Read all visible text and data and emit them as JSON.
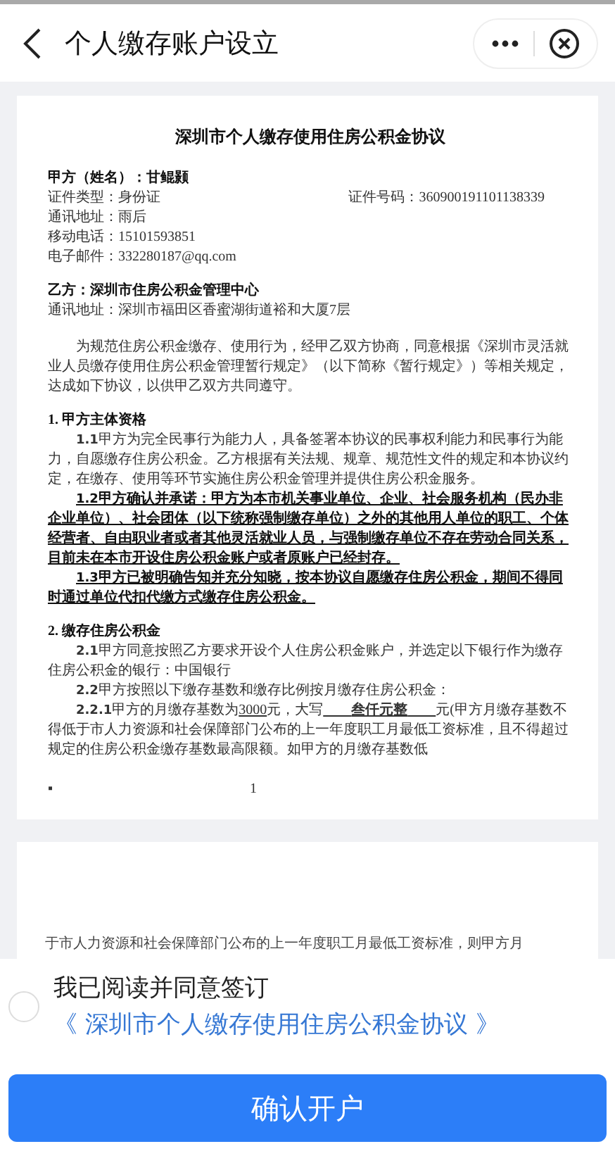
{
  "header": {
    "title": "个人缴存账户设立"
  },
  "document": {
    "title": "深圳市个人缴存使用住房公积金协议",
    "party_a": {
      "heading": "甲方（姓名）：甘鲲颢",
      "id_type": "证件类型：身份证",
      "id_number": "证件号码：360900191101138339",
      "address": "通讯地址：雨后",
      "phone": "移动电话：15101593851",
      "email": "电子邮件：332280187@qq.com"
    },
    "party_b": {
      "heading": "乙方：深圳市住房公积金管理中心",
      "address": "通讯地址：深圳市福田区香蜜湖街道裕和大厦7层"
    },
    "preamble": "为规范住房公积金缴存、使用行为，经甲乙双方协商，同意根据《深圳市灵活就业人员缴存使用住房公积金管理暂行规定》（以下简称《暂行规定》）等相关规定，达成如下协议，以供甲乙双方共同遵守。",
    "sections": [
      {
        "heading": "1. 甲方主体资格",
        "clauses": [
          {
            "number": "1.1",
            "emphasis": false,
            "parts": [
              {
                "text": "甲方为完全民事行为能力人，具备签署本协议的民事权利能力和民事行为能力，自愿缴存住房公积金。乙方根据有关法规、规章、规范性文件的规定和本协议约定，在缴存、使用等环节实施住房公积金管理并提供住房公积金服务。",
                "underline": false
              }
            ]
          },
          {
            "number": "1.2",
            "emphasis": true,
            "parts": [
              {
                "text": "甲方确认并承诺：甲方为本市机关事业单位、企业、社会服务机构（民办非企业单位）、社会团体（以下统称强制缴存单位）之外的其他用人单位的职工、个体经营者、自由职业者或者其他灵活就业人员，与强制缴存单位不存在劳动合同关系，目前未在本市开设住房公积金账户或者原账户已经封存。",
                "underline": true
              }
            ]
          },
          {
            "number": "1.3",
            "emphasis": true,
            "parts": [
              {
                "text": "甲方已被明确告知并充分知晓，按本协议自愿缴存住房公积金，期间不得同时通过单位代扣代缴方式缴存住房公积金。",
                "underline": true
              }
            ]
          }
        ]
      },
      {
        "heading": "2. 缴存住房公积金",
        "clauses": [
          {
            "number": "2.1",
            "emphasis": false,
            "parts": [
              {
                "text": "甲方同意按照乙方要求开设个人住房公积金账户，并选定以下银行作为缴存住房公积金的银行：中国银行",
                "underline": false
              }
            ]
          },
          {
            "number": "2.2",
            "emphasis": false,
            "parts": [
              {
                "text": "甲方按照以下缴存基数和缴存比例按月缴存住房公积金：",
                "underline": false
              }
            ]
          },
          {
            "number": "2.2.1",
            "emphasis": false,
            "parts": [
              {
                "text": "甲方的月缴存基数为",
                "underline": false
              },
              {
                "text": "3000",
                "underline": true
              },
              {
                "text": "元，大写",
                "underline": false
              },
              {
                "text": "　　**叁仟元整**　　",
                "underline": true
              },
              {
                "text": "元(甲方月缴存基数不得低于市人力资源和社会保障部门公布的上一年度职工月最低工资标准，且不得超过规定的住房公积金缴存基数最高限额。如甲方的月缴存基数低",
                "underline": false
              }
            ]
          }
        ]
      }
    ],
    "page_mark": "▪",
    "page_number": "1",
    "next_page_text": "于市人力资源和社会保障部门公布的上一年度职工月最低工资标准，则甲方月"
  },
  "consent": {
    "checked": false,
    "label": "我已阅读并同意签订",
    "link": "《 深圳市个人缴存使用住房公积金协议 》"
  },
  "confirm_button": "确认开户"
}
